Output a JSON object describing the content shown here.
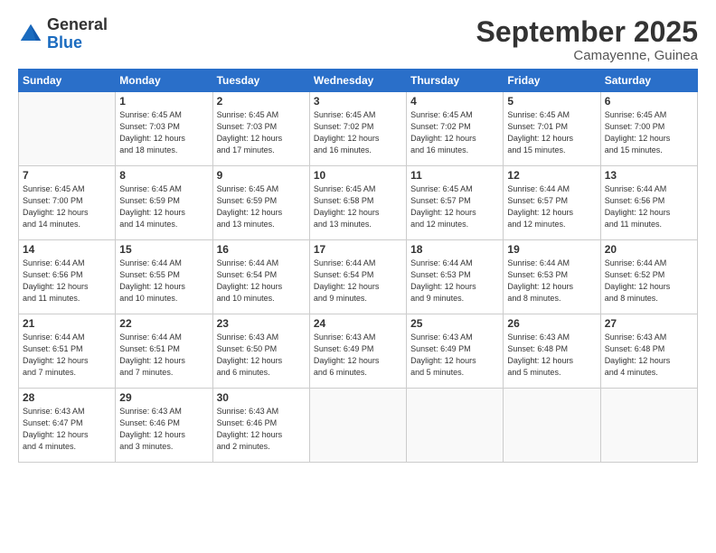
{
  "header": {
    "logo_general": "General",
    "logo_blue": "Blue",
    "month_title": "September 2025",
    "location": "Camayenne, Guinea"
  },
  "days_of_week": [
    "Sunday",
    "Monday",
    "Tuesday",
    "Wednesday",
    "Thursday",
    "Friday",
    "Saturday"
  ],
  "weeks": [
    [
      {
        "day": "",
        "empty": true
      },
      {
        "day": "1",
        "sunrise": "6:45 AM",
        "sunset": "7:03 PM",
        "daylight": "12 hours and 18 minutes."
      },
      {
        "day": "2",
        "sunrise": "6:45 AM",
        "sunset": "7:03 PM",
        "daylight": "12 hours and 17 minutes."
      },
      {
        "day": "3",
        "sunrise": "6:45 AM",
        "sunset": "7:02 PM",
        "daylight": "12 hours and 16 minutes."
      },
      {
        "day": "4",
        "sunrise": "6:45 AM",
        "sunset": "7:02 PM",
        "daylight": "12 hours and 16 minutes."
      },
      {
        "day": "5",
        "sunrise": "6:45 AM",
        "sunset": "7:01 PM",
        "daylight": "12 hours and 15 minutes."
      },
      {
        "day": "6",
        "sunrise": "6:45 AM",
        "sunset": "7:00 PM",
        "daylight": "12 hours and 15 minutes."
      }
    ],
    [
      {
        "day": "7",
        "sunrise": "6:45 AM",
        "sunset": "7:00 PM",
        "daylight": "12 hours and 14 minutes."
      },
      {
        "day": "8",
        "sunrise": "6:45 AM",
        "sunset": "6:59 PM",
        "daylight": "12 hours and 14 minutes."
      },
      {
        "day": "9",
        "sunrise": "6:45 AM",
        "sunset": "6:59 PM",
        "daylight": "12 hours and 13 minutes."
      },
      {
        "day": "10",
        "sunrise": "6:45 AM",
        "sunset": "6:58 PM",
        "daylight": "12 hours and 13 minutes."
      },
      {
        "day": "11",
        "sunrise": "6:45 AM",
        "sunset": "6:57 PM",
        "daylight": "12 hours and 12 minutes."
      },
      {
        "day": "12",
        "sunrise": "6:44 AM",
        "sunset": "6:57 PM",
        "daylight": "12 hours and 12 minutes."
      },
      {
        "day": "13",
        "sunrise": "6:44 AM",
        "sunset": "6:56 PM",
        "daylight": "12 hours and 11 minutes."
      }
    ],
    [
      {
        "day": "14",
        "sunrise": "6:44 AM",
        "sunset": "6:56 PM",
        "daylight": "12 hours and 11 minutes."
      },
      {
        "day": "15",
        "sunrise": "6:44 AM",
        "sunset": "6:55 PM",
        "daylight": "12 hours and 10 minutes."
      },
      {
        "day": "16",
        "sunrise": "6:44 AM",
        "sunset": "6:54 PM",
        "daylight": "12 hours and 10 minutes."
      },
      {
        "day": "17",
        "sunrise": "6:44 AM",
        "sunset": "6:54 PM",
        "daylight": "12 hours and 9 minutes."
      },
      {
        "day": "18",
        "sunrise": "6:44 AM",
        "sunset": "6:53 PM",
        "daylight": "12 hours and 9 minutes."
      },
      {
        "day": "19",
        "sunrise": "6:44 AM",
        "sunset": "6:53 PM",
        "daylight": "12 hours and 8 minutes."
      },
      {
        "day": "20",
        "sunrise": "6:44 AM",
        "sunset": "6:52 PM",
        "daylight": "12 hours and 8 minutes."
      }
    ],
    [
      {
        "day": "21",
        "sunrise": "6:44 AM",
        "sunset": "6:51 PM",
        "daylight": "12 hours and 7 minutes."
      },
      {
        "day": "22",
        "sunrise": "6:44 AM",
        "sunset": "6:51 PM",
        "daylight": "12 hours and 7 minutes."
      },
      {
        "day": "23",
        "sunrise": "6:43 AM",
        "sunset": "6:50 PM",
        "daylight": "12 hours and 6 minutes."
      },
      {
        "day": "24",
        "sunrise": "6:43 AM",
        "sunset": "6:49 PM",
        "daylight": "12 hours and 6 minutes."
      },
      {
        "day": "25",
        "sunrise": "6:43 AM",
        "sunset": "6:49 PM",
        "daylight": "12 hours and 5 minutes."
      },
      {
        "day": "26",
        "sunrise": "6:43 AM",
        "sunset": "6:48 PM",
        "daylight": "12 hours and 5 minutes."
      },
      {
        "day": "27",
        "sunrise": "6:43 AM",
        "sunset": "6:48 PM",
        "daylight": "12 hours and 4 minutes."
      }
    ],
    [
      {
        "day": "28",
        "sunrise": "6:43 AM",
        "sunset": "6:47 PM",
        "daylight": "12 hours and 4 minutes."
      },
      {
        "day": "29",
        "sunrise": "6:43 AM",
        "sunset": "6:46 PM",
        "daylight": "12 hours and 3 minutes."
      },
      {
        "day": "30",
        "sunrise": "6:43 AM",
        "sunset": "6:46 PM",
        "daylight": "12 hours and 2 minutes."
      },
      {
        "day": "",
        "empty": true
      },
      {
        "day": "",
        "empty": true
      },
      {
        "day": "",
        "empty": true
      },
      {
        "day": "",
        "empty": true
      }
    ]
  ]
}
